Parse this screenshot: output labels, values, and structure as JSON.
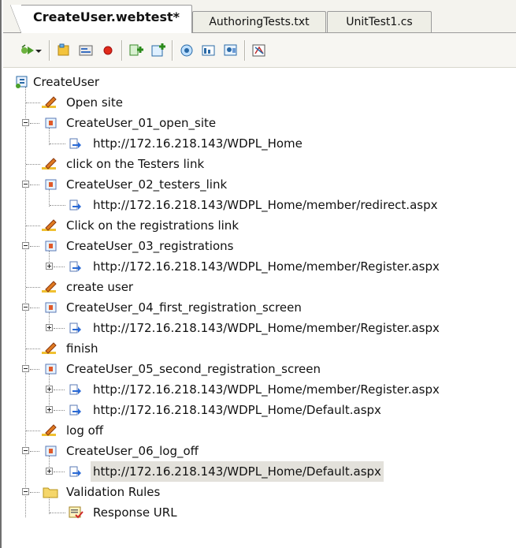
{
  "tabs": [
    {
      "label": "CreateUser.webtest*",
      "active": true
    },
    {
      "label": "AuthoringTests.txt",
      "active": false
    },
    {
      "label": "UnitTest1.cs",
      "active": false
    }
  ],
  "toolbar": {
    "buttons": [
      "run-test-icon",
      "dropdown-arrow-icon",
      "add-comment-icon",
      "add-transaction-icon",
      "record-icon",
      "insert-request-icon",
      "insert-web-service-icon",
      "add-validation-rule-icon",
      "add-data-source-icon",
      "set-credentials-icon",
      "parameterize-icon",
      "generate-code-icon"
    ]
  },
  "tree": {
    "root": "CreateUser",
    "items": [
      {
        "label": "Open site"
      },
      {
        "label": "CreateUser_01_open_site"
      },
      {
        "label": "http://172.16.218.143/WDPL_Home"
      },
      {
        "label": "click on the Testers link"
      },
      {
        "label": "CreateUser_02_testers_link"
      },
      {
        "label": "http://172.16.218.143/WDPL_Home/member/redirect.aspx"
      },
      {
        "label": "Click on the registrations link"
      },
      {
        "label": "CreateUser_03_registrations"
      },
      {
        "label": "http://172.16.218.143/WDPL_Home/member/Register.aspx"
      },
      {
        "label": "create user"
      },
      {
        "label": "CreateUser_04_first_registration_screen"
      },
      {
        "label": "http://172.16.218.143/WDPL_Home/member/Register.aspx"
      },
      {
        "label": "finish"
      },
      {
        "label": "CreateUser_05_second_registration_screen"
      },
      {
        "label": "http://172.16.218.143/WDPL_Home/member/Register.aspx"
      },
      {
        "label": "http://172.16.218.143/WDPL_Home/Default.aspx"
      },
      {
        "label": "log off"
      },
      {
        "label": "CreateUser_06_log_off"
      },
      {
        "label": "http://172.16.218.143/WDPL_Home/Default.aspx"
      },
      {
        "label": "Validation Rules"
      },
      {
        "label": "Response URL"
      }
    ]
  }
}
